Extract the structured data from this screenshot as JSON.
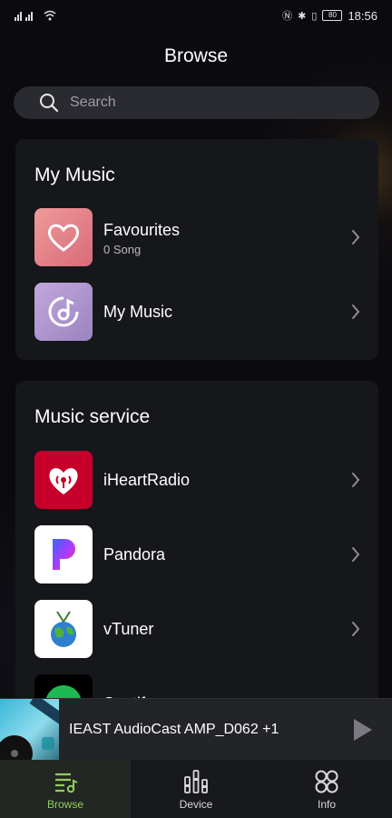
{
  "status_bar": {
    "left_icons": [
      "signal-icon",
      "wifi-icon"
    ],
    "right_icons": [
      "nfc-icon",
      "bluetooth-icon",
      "vibrate-icon"
    ],
    "battery": "80",
    "time": "18:56"
  },
  "header": {
    "title": "Browse"
  },
  "search": {
    "placeholder": "Search"
  },
  "my_music": {
    "title": "My Music",
    "items": [
      {
        "title": "Favourites",
        "subtitle": "0 Song",
        "icon": "heart-icon",
        "color": "#e07d84"
      },
      {
        "title": "My Music",
        "icon": "music-note-icon",
        "color": "#a88bc4"
      }
    ]
  },
  "music_service": {
    "title": "Music service",
    "items": [
      {
        "title": "iHeartRadio",
        "icon": "iheartradio-logo",
        "color": "#c6002b"
      },
      {
        "title": "Pandora",
        "icon": "pandora-logo",
        "color": "#ffffff"
      },
      {
        "title": "vTuner",
        "icon": "vtuner-logo",
        "color": "#ffffff"
      },
      {
        "title": "Spotify",
        "icon": "spotify-logo",
        "color": "#1db954"
      }
    ]
  },
  "now_playing": {
    "title": "IEAST AudioCast AMP_D062  +1"
  },
  "bottom_nav": {
    "items": [
      {
        "label": "Browse",
        "icon": "browse-music-icon",
        "active": true,
        "color": "#8fcf5a"
      },
      {
        "label": "Device",
        "icon": "equalizer-icon",
        "active": false
      },
      {
        "label": "Info",
        "icon": "info-grid-icon",
        "active": false
      }
    ]
  }
}
